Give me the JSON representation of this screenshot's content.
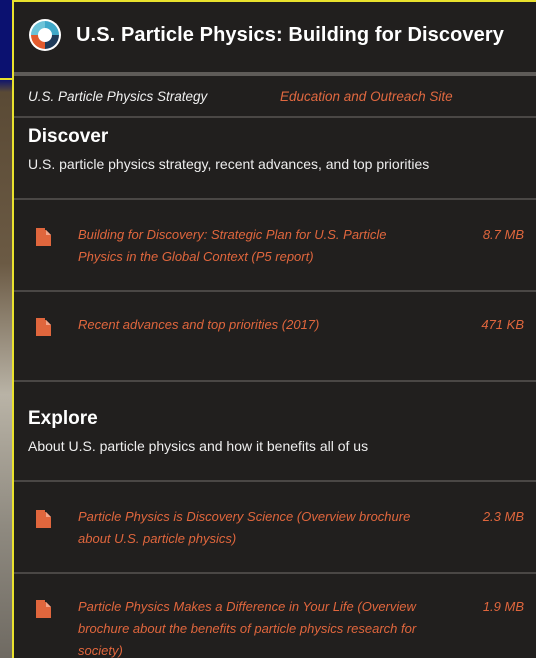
{
  "header": {
    "title": "U.S. Particle Physics: Building for Discovery"
  },
  "nav": {
    "item1": "U.S. Particle Physics Strategy",
    "item2": "Education and Outreach Site"
  },
  "sections": [
    {
      "title": "Discover",
      "description": "U.S. particle physics strategy, recent advances, and top priorities",
      "items": [
        {
          "label": "Building for Discovery: Strategic Plan for U.S. Particle Physics in the Global Context (P5 report)",
          "size": "8.7 MB"
        },
        {
          "label": "Recent advances and top priorities (2017)",
          "size": "471 KB"
        }
      ]
    },
    {
      "title": "Explore",
      "description": "About U.S. particle physics and how it benefits all of us",
      "items": [
        {
          "label": "Particle Physics is Discovery Science (Overview brochure about U.S. particle physics)",
          "size": "2.3 MB"
        },
        {
          "label": "Particle Physics Makes a Difference in Your Life (Overview brochure about the benefits of particle physics research for society)",
          "size": "1.9 MB"
        }
      ]
    }
  ],
  "colors": {
    "link": "#e0663d",
    "panel_bg": "#211f1e",
    "frame": "#e9e22d"
  },
  "icons": {
    "logo": "swirl-logo-icon",
    "document": "pdf-document-icon"
  }
}
